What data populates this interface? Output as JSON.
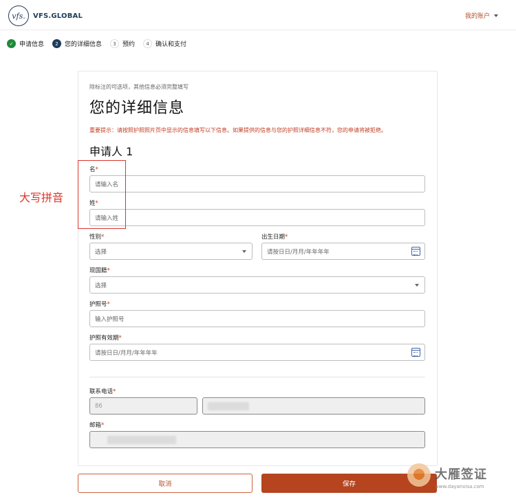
{
  "header": {
    "logo_mark": "vfs.",
    "logo_text": "VFS.GLOBAL",
    "account": "我的账户"
  },
  "steps": [
    {
      "num": "✓",
      "label": "申请信息",
      "state": "done"
    },
    {
      "num": "2",
      "label": "您的详细信息",
      "state": "active"
    },
    {
      "num": "3",
      "label": "预约",
      "state": "todo"
    },
    {
      "num": "4",
      "label": "确认和支付",
      "state": "todo"
    }
  ],
  "form": {
    "hint": "除标注的可选项，其他信息必须完整填写",
    "title": "您的详细信息",
    "warning": "重要提示：请按照护照照片页中显示的信息填写以下信息。如果提供的信息与您的护照详细信息不符，您的申请将被拒绝。",
    "applicant": "申请人 1",
    "required_mark": "*",
    "first_name": {
      "label": "名",
      "placeholder": "请输入名"
    },
    "last_name": {
      "label": "姓",
      "placeholder": "请输入姓"
    },
    "gender": {
      "label": "性别",
      "value": "选择"
    },
    "dob": {
      "label": "出生日期",
      "placeholder": "请按日日/月月/年年年年"
    },
    "nationality": {
      "label": "现国籍",
      "value": "选择"
    },
    "passport_no": {
      "label": "护照号",
      "placeholder": "输入护照号"
    },
    "passport_expiry": {
      "label": "护照有效期",
      "placeholder": "请按日日/月月/年年年年"
    },
    "phone": {
      "label": "联系电话",
      "code": "86"
    },
    "email": {
      "label": "邮箱"
    }
  },
  "annotation": {
    "text": "大写拼音",
    "color": "#d9352b"
  },
  "buttons": {
    "cancel": "取消",
    "save": "保存"
  },
  "watermark": {
    "name": "大雁签证",
    "url": "www.dayanvisa.com"
  },
  "colors": {
    "accent": "#b5441f",
    "navy": "#1f3b5c",
    "success": "#1e8a3a",
    "error": "#c23b22"
  }
}
